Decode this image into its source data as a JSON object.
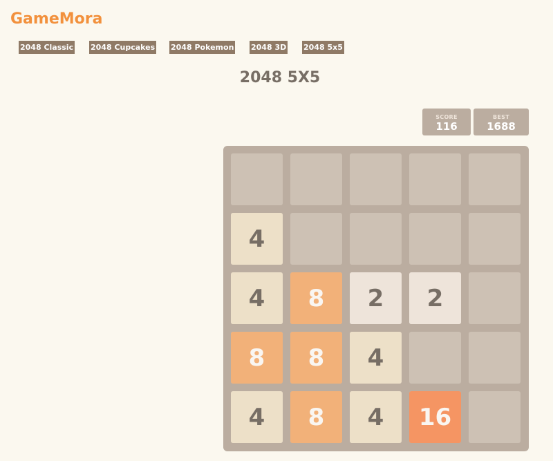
{
  "site": {
    "brand": "GameMora"
  },
  "nav": [
    {
      "label": "2048 Classic"
    },
    {
      "label": "2048 Cupcakes"
    },
    {
      "label": "2048 Pokemon"
    },
    {
      "label": "2048 3D"
    },
    {
      "label": "2048 5x5"
    }
  ],
  "game": {
    "title": "2048 5X5",
    "score_label": "SCORE",
    "score": "116",
    "best_label": "BEST",
    "best": "1688",
    "board": [
      [
        null,
        null,
        null,
        null,
        null
      ],
      [
        4,
        null,
        null,
        null,
        null
      ],
      [
        4,
        8,
        2,
        2,
        null
      ],
      [
        8,
        8,
        4,
        null,
        null
      ],
      [
        4,
        8,
        4,
        16,
        null
      ]
    ]
  },
  "colors": {
    "background": "#fbf8ef",
    "brand": "#f2913d",
    "nav_button": "#8f7a66",
    "board": "#bbada0",
    "empty_cell": "#cdc1b4",
    "tile_2": "#eee4da",
    "tile_4": "#ede0c8",
    "tile_8": "#f2b179",
    "tile_16": "#f59563"
  }
}
